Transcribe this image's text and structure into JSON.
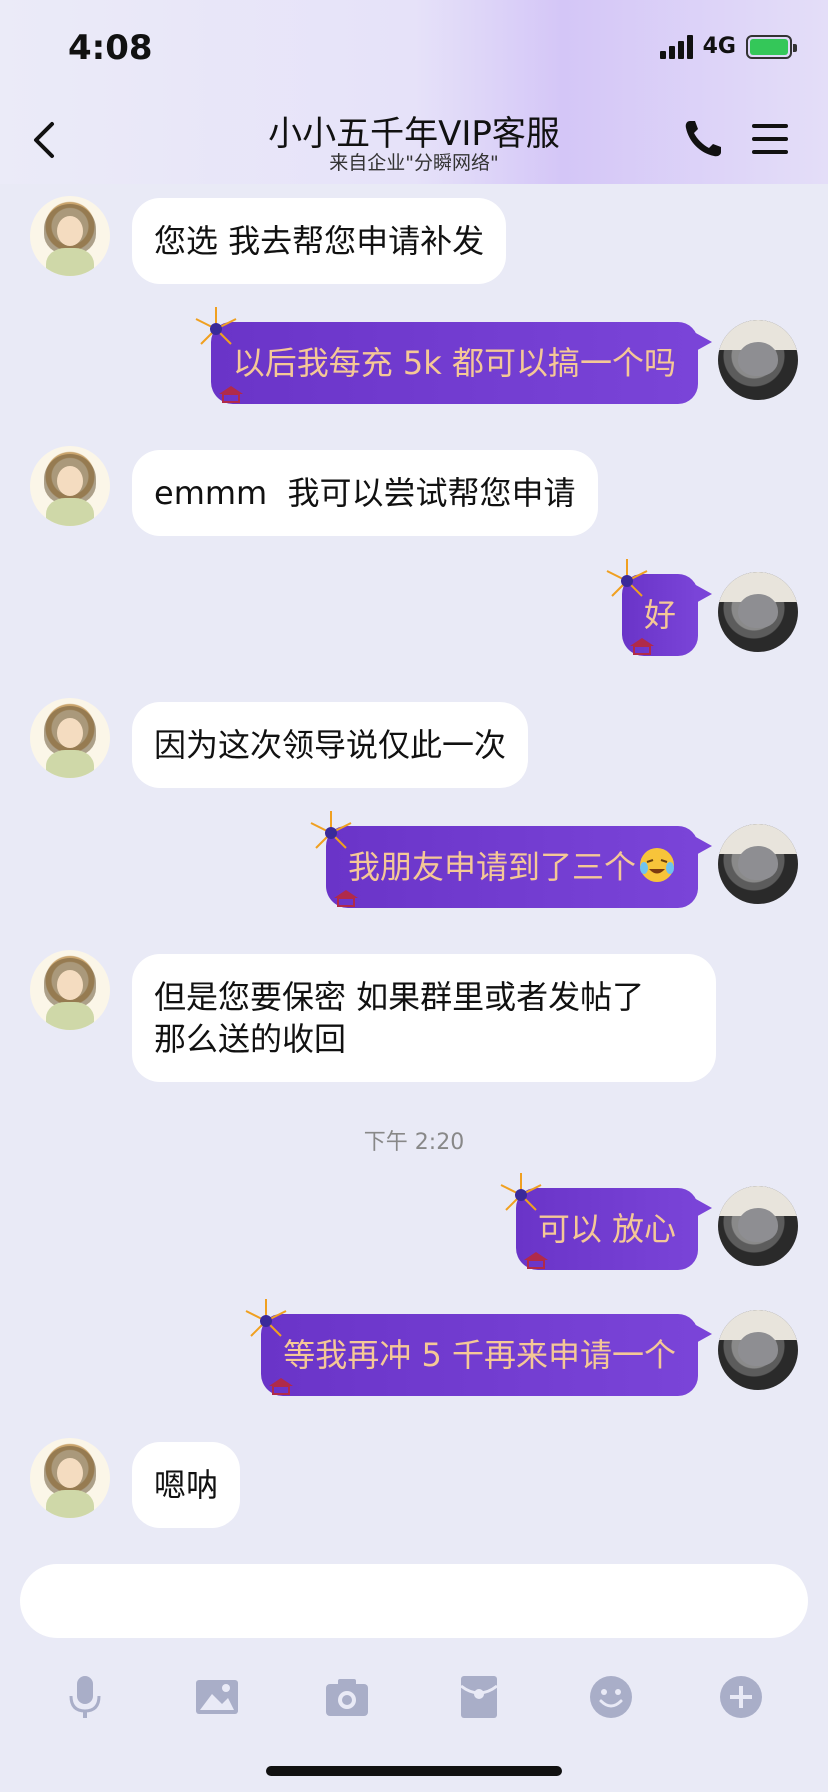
{
  "status_bar": {
    "time": "4:08",
    "network": "4G"
  },
  "header": {
    "title": "小小五千年VIP客服",
    "subtitle": "来自企业\"分瞬网络\""
  },
  "messages": [
    {
      "side": "in",
      "text": "您选 我去帮您申请补发"
    },
    {
      "side": "out",
      "text": "以后我每充 5k 都可以搞一个吗"
    },
    {
      "side": "in",
      "text": "emmm  我可以尝试帮您申请"
    },
    {
      "side": "out",
      "text": "好"
    },
    {
      "side": "in",
      "text": "因为这次领导说仅此一次"
    },
    {
      "side": "out",
      "text": "我朋友申请到了三个"
    },
    {
      "side": "in",
      "line1": "但是您要保密 如果群里或者发帖了",
      "line2": "那么送的收回"
    },
    {
      "side": "out",
      "text": "可以 放心"
    },
    {
      "side": "out",
      "text": "等我再冲 5 千再来申请一个"
    },
    {
      "side": "in",
      "text": "嗯呐"
    }
  ],
  "timestamp": "下午 2:20",
  "input": {
    "value": ""
  },
  "colors": {
    "bubble_out": "#6a34c8",
    "bubble_out_text": "#f5c896",
    "background": "#e9eaf6"
  },
  "toolbar_icons": [
    "microphone-icon",
    "image-icon",
    "camera-icon",
    "red-packet-icon",
    "emoji-icon",
    "plus-icon"
  ]
}
